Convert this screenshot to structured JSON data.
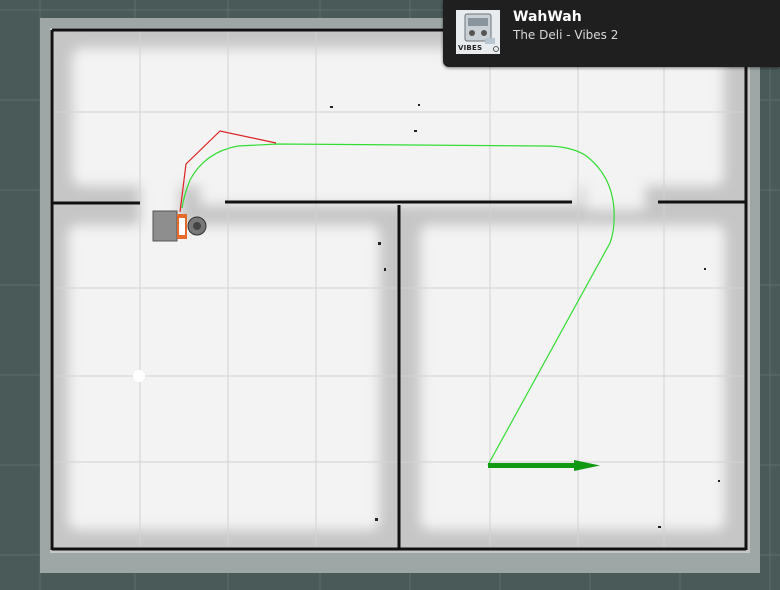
{
  "notification": {
    "title": "WahWah",
    "subtitle": "The Deli - Vibes 2",
    "album_art_text": "VIBES",
    "album_art_icon": "radio-cassette-album-art"
  },
  "map_view": {
    "background_color": "#4a5a59",
    "free_space_color": "#f2f2f2",
    "unknown_space_color": "#c8c8c8",
    "obstacle_color": "#111111",
    "grid_color": "#d6d6d6",
    "global_plan_color": "#33dd33",
    "local_plan_color": "#dd2222",
    "goal_arrow_color": "#119911",
    "robot_icon": "turtlebot-robot-icon",
    "goal_icon": "goal-pose-arrow-icon"
  }
}
